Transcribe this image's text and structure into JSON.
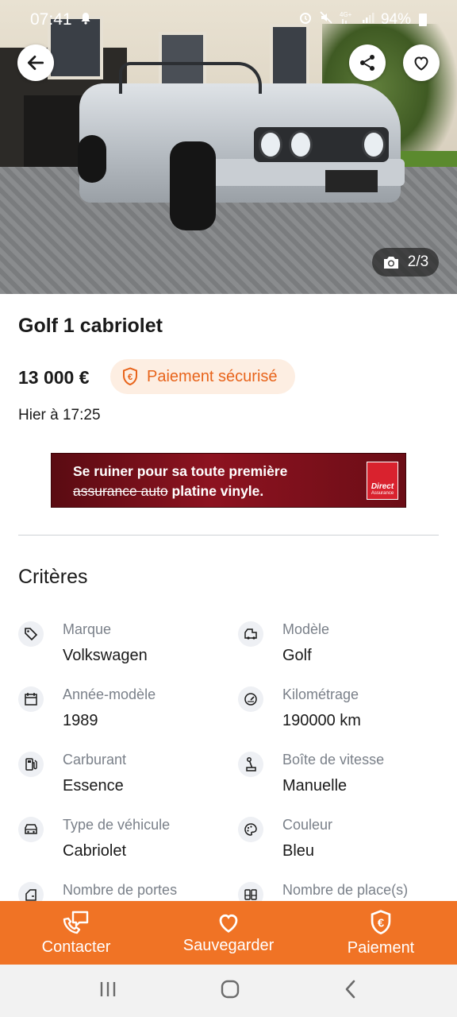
{
  "status_bar": {
    "time": "07:41",
    "battery": "94%"
  },
  "gallery": {
    "counter": "2/3"
  },
  "listing": {
    "title": "Golf 1 cabriolet",
    "price": "13 000 €",
    "secure_payment_label": "Paiement sécurisé",
    "date": "Hier à 17:25"
  },
  "ad": {
    "line1": "Se ruiner pour sa toute première",
    "line2_struck": "assurance auto",
    "line2_rest": " platine vinyle.",
    "logo_line1": "Direct",
    "logo_line2": "Assurance"
  },
  "criteria": {
    "title": "Critères",
    "items": [
      {
        "label": "Marque",
        "value": "Volkswagen",
        "icon": "tag-icon"
      },
      {
        "label": "Modèle",
        "value": "Golf",
        "icon": "car-model-icon"
      },
      {
        "label": "Année-modèle",
        "value": "1989",
        "icon": "calendar-icon"
      },
      {
        "label": "Kilométrage",
        "value": "190000 km",
        "icon": "speedometer-icon"
      },
      {
        "label": "Carburant",
        "value": "Essence",
        "icon": "fuel-pump-icon"
      },
      {
        "label": "Boîte de vitesse",
        "value": "Manuelle",
        "icon": "gear-stick-icon"
      },
      {
        "label": "Type de véhicule",
        "value": "Cabriolet",
        "icon": "vehicle-type-icon"
      },
      {
        "label": "Couleur",
        "value": "Bleu",
        "icon": "palette-icon"
      },
      {
        "label": "Nombre de portes",
        "value": "",
        "icon": "door-icon"
      },
      {
        "label": "Nombre de place(s)",
        "value": "",
        "icon": "seats-icon"
      }
    ]
  },
  "actions": {
    "contact": "Contacter",
    "save": "Sauvegarder",
    "pay": "Paiement"
  },
  "colors": {
    "accent": "#f07325",
    "secure_text": "#e8641b",
    "secure_bg": "#fdeee2"
  }
}
